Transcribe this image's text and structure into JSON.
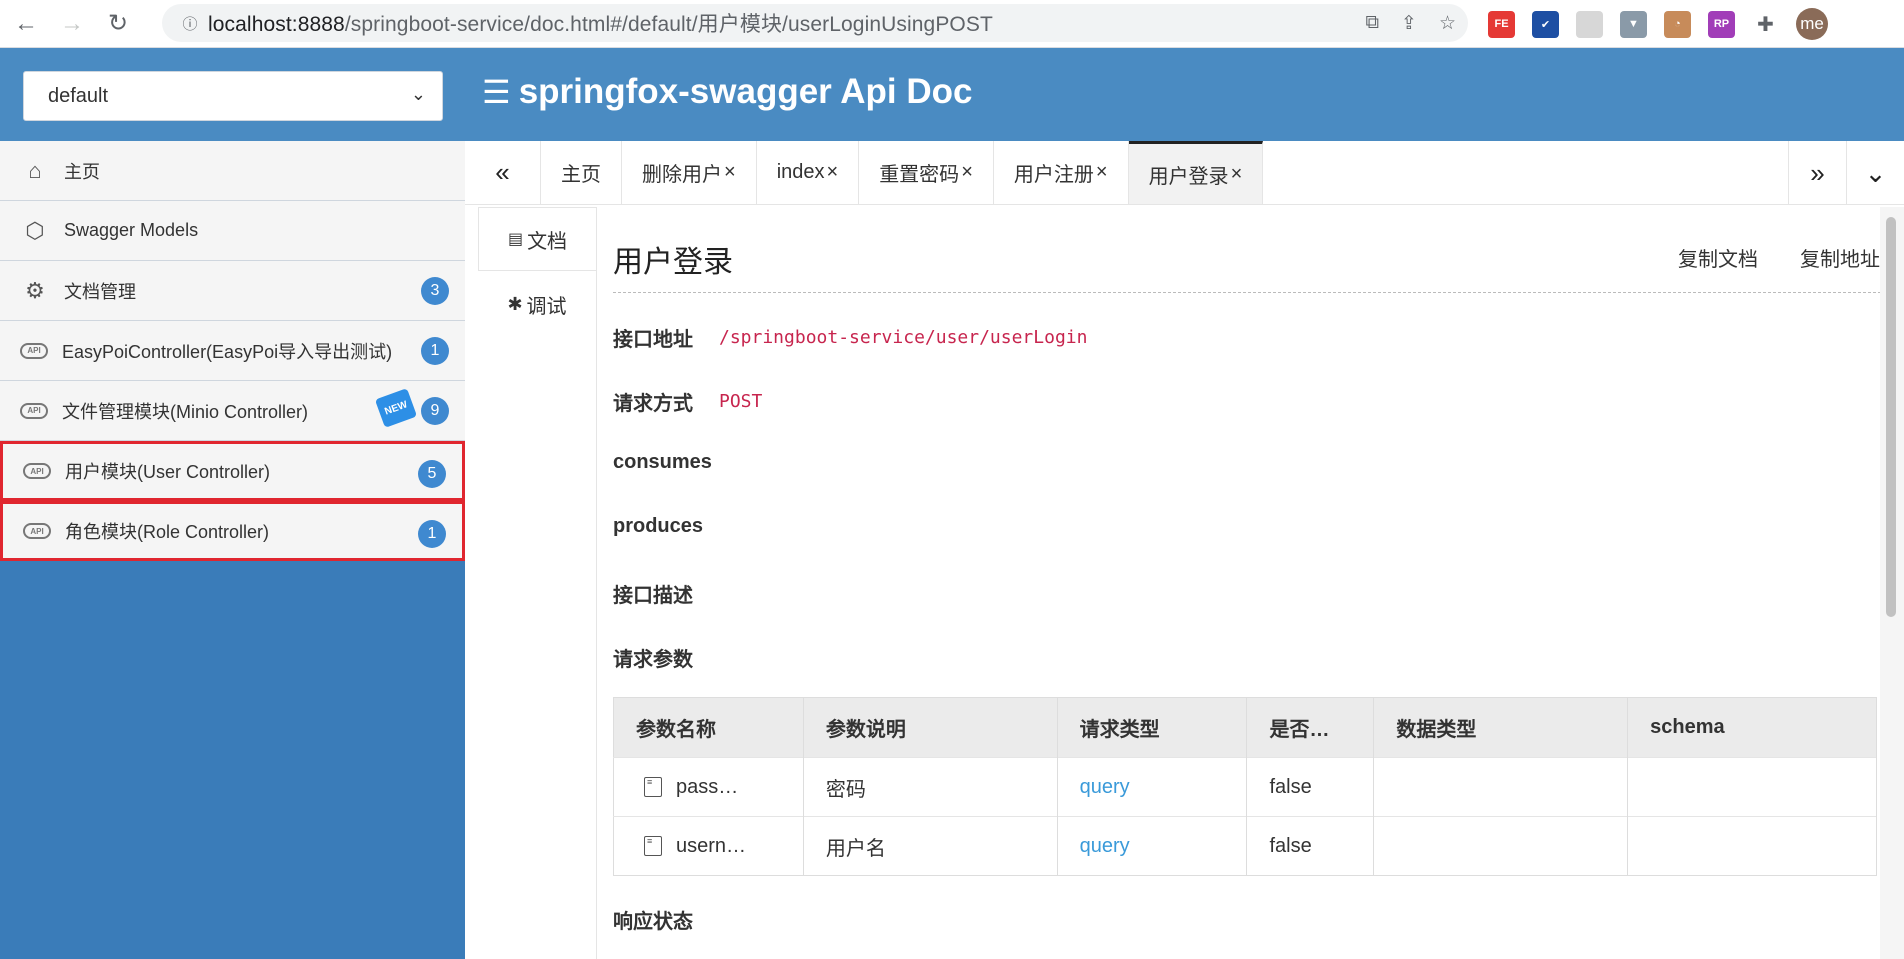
{
  "browser": {
    "url_host": "localhost:8888",
    "url_path": "/springboot-service/doc.html#/default/用户模块/userLoginUsingPOST",
    "avatar": "me",
    "extensions": [
      {
        "name": "fe-extension-icon",
        "label": "FE",
        "color": "#e53935"
      },
      {
        "name": "check-extension-icon",
        "label": "✔",
        "color": "#1e4fa3"
      },
      {
        "name": "gray-extension-icon",
        "label": "",
        "color": "#d7d7d7"
      },
      {
        "name": "vue-extension-icon",
        "label": "▼",
        "color": "#8a9aa8"
      },
      {
        "name": "glasses-extension-icon",
        "label": "◔",
        "color": "#c78b5a"
      },
      {
        "name": "rp-extension-icon",
        "label": "RP",
        "color": "#a13db8"
      }
    ]
  },
  "header": {
    "group_select": "default",
    "title": "springfox-swagger Api Doc"
  },
  "sidebar": {
    "items": [
      {
        "label": "主页",
        "icon": "home-icon",
        "badge": ""
      },
      {
        "label": "Swagger Models",
        "icon": "models-icon",
        "badge": ""
      },
      {
        "label": "文档管理",
        "icon": "doc-settings-icon",
        "badge": "3"
      },
      {
        "label": "EasyPoiController(EasyPoi导入导出测试)",
        "icon": "api-cloud-icon",
        "badge": "1"
      },
      {
        "label": "文件管理模块(Minio Controller)",
        "icon": "api-cloud-icon",
        "badge": "9",
        "new": "NEW"
      },
      {
        "label": "用户模块(User Controller)",
        "icon": "api-cloud-icon",
        "badge": "5",
        "highlight": true
      },
      {
        "label": "角色模块(Role Controller)",
        "icon": "api-cloud-icon",
        "badge": "1",
        "highlight": true
      }
    ]
  },
  "tabs": {
    "items": [
      {
        "label": "主页",
        "closable": false
      },
      {
        "label": "删除用户",
        "closable": true
      },
      {
        "label": "index",
        "closable": true
      },
      {
        "label": "重置密码",
        "closable": true
      },
      {
        "label": "用户注册",
        "closable": true
      },
      {
        "label": "用户登录",
        "closable": true,
        "active": true
      }
    ],
    "close_glyph": "×"
  },
  "content_tabs": {
    "doc": "文档",
    "debug": "调试"
  },
  "api": {
    "title": "用户登录",
    "copy_doc": "复制文档",
    "copy_url": "复制地址",
    "address_label": "接口地址",
    "address": "/springboot-service/user/userLogin",
    "method_label": "请求方式",
    "method": "POST",
    "consumes_label": "consumes",
    "produces_label": "produces",
    "desc_label": "接口描述",
    "params_label": "请求参数",
    "response_label": "响应状态"
  },
  "params_table": {
    "headers": [
      "参数名称",
      "参数说明",
      "请求类型",
      "是否…",
      "数据类型",
      "schema"
    ],
    "rows": [
      [
        "pass…",
        "密码",
        "query",
        "false",
        "",
        ""
      ],
      [
        "usern…",
        "用户名",
        "query",
        "false",
        "",
        ""
      ]
    ]
  }
}
